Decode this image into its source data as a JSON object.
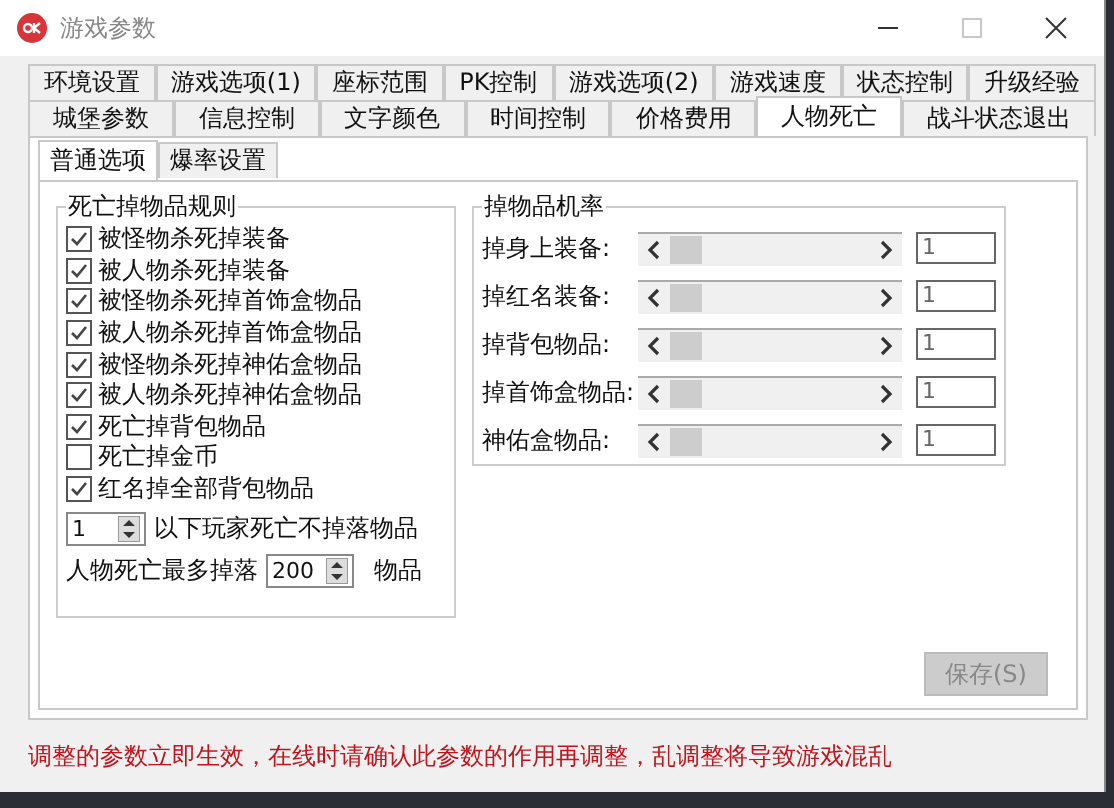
{
  "window": {
    "title": "游戏参数"
  },
  "tab_rows": [
    [
      {
        "label": "环境设置",
        "selected": false
      },
      {
        "label": "游戏选项(1)",
        "selected": false
      },
      {
        "label": "座标范围",
        "selected": false
      },
      {
        "label": "PK控制",
        "selected": false
      },
      {
        "label": "游戏选项(2)",
        "selected": false
      },
      {
        "label": "游戏速度",
        "selected": false
      },
      {
        "label": "状态控制",
        "selected": false
      },
      {
        "label": "升级经验",
        "selected": false
      }
    ],
    [
      {
        "label": "城堡参数",
        "selected": false
      },
      {
        "label": "信息控制",
        "selected": false
      },
      {
        "label": "文字颜色",
        "selected": false
      },
      {
        "label": "时间控制",
        "selected": false
      },
      {
        "label": "价格费用",
        "selected": false
      },
      {
        "label": "人物死亡",
        "selected": true
      },
      {
        "label": "战斗状态退出",
        "selected": false
      }
    ]
  ],
  "subtabs": [
    {
      "label": "普通选项",
      "selected": true
    },
    {
      "label": "爆率设置",
      "selected": false
    }
  ],
  "death_rules": {
    "title": "死亡掉物品规则",
    "items": [
      {
        "label": "被怪物杀死掉装备",
        "checked": true
      },
      {
        "label": "被人物杀死掉装备",
        "checked": true
      },
      {
        "label": "被怪物杀死掉首饰盒物品",
        "checked": true
      },
      {
        "label": "被人物杀死掉首饰盒物品",
        "checked": true
      },
      {
        "label": "被怪物杀死掉神佑盒物品",
        "checked": true
      },
      {
        "label": "被人物杀死掉神佑盒物品",
        "checked": true
      },
      {
        "label": "死亡掉背包物品",
        "checked": true
      },
      {
        "label": "死亡掉金币",
        "checked": false
      },
      {
        "label": "红名掉全部背包物品",
        "checked": true
      }
    ],
    "min_level": {
      "value": "1",
      "label": "以下玩家死亡不掉落物品"
    },
    "max_drop": {
      "label": "人物死亡最多掉落",
      "value": "200",
      "unit": "物品"
    }
  },
  "drop_rates": {
    "title": "掉物品机率",
    "rows": [
      {
        "label": "掉身上装备:",
        "value": "1"
      },
      {
        "label": "掉红名装备:",
        "value": "1"
      },
      {
        "label": "掉背包物品:",
        "value": "1"
      },
      {
        "label": "掉首饰盒物品:",
        "value": "1"
      },
      {
        "label": "神佑盒物品:",
        "value": "1"
      }
    ]
  },
  "save_button": {
    "label": "保存(S)",
    "disabled": true
  },
  "notice": "调整的参数立即生效，在线时请确认此参数的作用再调整，乱调整将导致游戏混乱"
}
